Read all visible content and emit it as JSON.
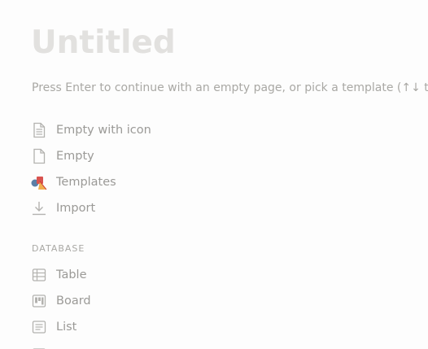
{
  "page": {
    "title": "Untitled",
    "hint": "Press Enter to continue with an empty page, or pick a template (↑↓ to"
  },
  "actions": [
    {
      "label": "Empty with icon",
      "icon": "page-with-text-icon"
    },
    {
      "label": "Empty",
      "icon": "page-icon"
    },
    {
      "label": "Templates",
      "icon": "templates-icon"
    },
    {
      "label": "Import",
      "icon": "import-icon"
    }
  ],
  "database": {
    "section_label": "DATABASE",
    "items": [
      {
        "label": "Table",
        "icon": "table-icon"
      },
      {
        "label": "Board",
        "icon": "board-icon"
      },
      {
        "label": "List",
        "icon": "list-icon"
      }
    ]
  }
}
